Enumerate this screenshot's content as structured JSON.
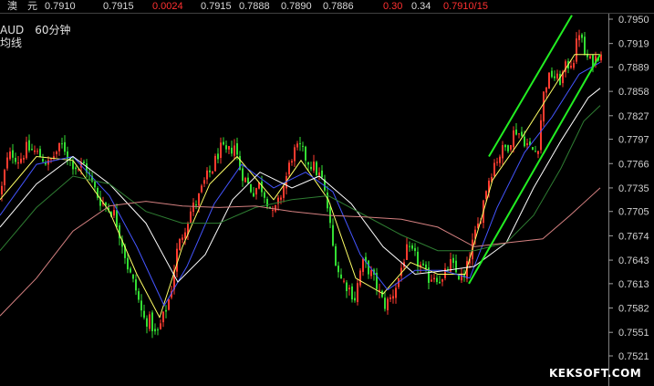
{
  "quote_bar": {
    "name": "澳　元",
    "fields": [
      {
        "value": "0.7910",
        "color": "white"
      },
      {
        "value": "0.7915",
        "color": "white"
      },
      {
        "value": "0.0024",
        "color": "red"
      },
      {
        "value": "0.7915",
        "color": "white"
      },
      {
        "value": "0.7888",
        "color": "white"
      },
      {
        "value": "0.7890",
        "color": "white"
      },
      {
        "value": "0.7886",
        "color": "white"
      },
      {
        "value": "0.30",
        "color": "red"
      },
      {
        "value": "0.34",
        "color": "white"
      },
      {
        "value": "0.7910/15",
        "color": "red"
      }
    ]
  },
  "symbol_label": "AUD　60分钟",
  "indicator_label": "均线",
  "watermark": "KEKSOFT.COM",
  "colors": {
    "background": "#000000",
    "up_candle": "#ff3b2f",
    "down_candle": "#33dd33",
    "ma_short": "#ffff66",
    "ma_mid": "#ffffff",
    "ma_blue": "#4455ff",
    "ma_green": "#2e7d32",
    "ma_long": "#d48080",
    "channel": "#22ee22"
  },
  "chart_data": {
    "type": "candlestick",
    "ylim": [
      0.7515,
      0.796
    ],
    "y_ticks": [
      "0.7950",
      "0.7919",
      "0.7889",
      "0.7858",
      "0.7827",
      "0.7797",
      "0.7766",
      "0.7735",
      "0.7705",
      "0.7674",
      "0.7643",
      "0.7613",
      "0.7582",
      "0.7551",
      "0.7521"
    ],
    "close_path": [
      [
        0,
        0.7728
      ],
      [
        6,
        0.7768
      ],
      [
        12,
        0.778
      ],
      [
        20,
        0.777
      ],
      [
        28,
        0.7785
      ],
      [
        36,
        0.7782
      ],
      [
        44,
        0.7775
      ],
      [
        52,
        0.7765
      ],
      [
        60,
        0.778
      ],
      [
        68,
        0.779
      ],
      [
        76,
        0.777
      ],
      [
        84,
        0.776
      ],
      [
        92,
        0.7765
      ],
      [
        100,
        0.774
      ],
      [
        108,
        0.772
      ],
      [
        116,
        0.7712
      ],
      [
        124,
        0.7702
      ],
      [
        132,
        0.767
      ],
      [
        140,
        0.763
      ],
      [
        148,
        0.7605
      ],
      [
        156,
        0.7568
      ],
      [
        164,
        0.7565
      ],
      [
        170,
        0.7545
      ],
      [
        178,
        0.757
      ],
      [
        186,
        0.76
      ],
      [
        192,
        0.765
      ],
      [
        200,
        0.768
      ],
      [
        208,
        0.7705
      ],
      [
        216,
        0.772
      ],
      [
        224,
        0.7745
      ],
      [
        232,
        0.776
      ],
      [
        240,
        0.7785
      ],
      [
        248,
        0.7778
      ],
      [
        256,
        0.779
      ],
      [
        262,
        0.776
      ],
      [
        268,
        0.7745
      ],
      [
        276,
        0.773
      ],
      [
        284,
        0.774
      ],
      [
        292,
        0.772
      ],
      [
        298,
        0.77
      ],
      [
        304,
        0.7715
      ],
      [
        312,
        0.7745
      ],
      [
        320,
        0.778
      ],
      [
        328,
        0.7785
      ],
      [
        336,
        0.777
      ],
      [
        344,
        0.776
      ],
      [
        352,
        0.7745
      ],
      [
        358,
        0.771
      ],
      [
        364,
        0.766
      ],
      [
        372,
        0.762
      ],
      [
        380,
        0.761
      ],
      [
        388,
        0.7595
      ],
      [
        396,
        0.764
      ],
      [
        404,
        0.763
      ],
      [
        412,
        0.761
      ],
      [
        420,
        0.7585
      ],
      [
        428,
        0.7595
      ],
      [
        436,
        0.762
      ],
      [
        444,
        0.7655
      ],
      [
        452,
        0.765
      ],
      [
        460,
        0.7635
      ],
      [
        468,
        0.762
      ],
      [
        476,
        0.7625
      ],
      [
        484,
        0.7615
      ],
      [
        492,
        0.764
      ],
      [
        500,
        0.7625
      ],
      [
        508,
        0.7618
      ],
      [
        516,
        0.766
      ],
      [
        524,
        0.769
      ],
      [
        532,
        0.7735
      ],
      [
        540,
        0.7765
      ],
      [
        548,
        0.778
      ],
      [
        556,
        0.779
      ],
      [
        564,
        0.781
      ],
      [
        572,
        0.78
      ],
      [
        580,
        0.7785
      ],
      [
        588,
        0.778
      ],
      [
        596,
        0.7865
      ],
      [
        604,
        0.788
      ],
      [
        612,
        0.787
      ],
      [
        620,
        0.789
      ],
      [
        628,
        0.79
      ],
      [
        634,
        0.7935
      ],
      [
        640,
        0.7905
      ],
      [
        646,
        0.7895
      ],
      [
        652,
        0.79
      ],
      [
        658,
        0.7912
      ]
    ],
    "ma_series": [
      {
        "key": "ma_short",
        "points": [
          [
            0,
            0.772
          ],
          [
            40,
            0.7775
          ],
          [
            80,
            0.777
          ],
          [
            120,
            0.7705
          ],
          [
            150,
            0.7625
          ],
          [
            175,
            0.757
          ],
          [
            200,
            0.766
          ],
          [
            230,
            0.774
          ],
          [
            260,
            0.7775
          ],
          [
            300,
            0.772
          ],
          [
            330,
            0.777
          ],
          [
            360,
            0.772
          ],
          [
            390,
            0.762
          ],
          [
            420,
            0.76
          ],
          [
            450,
            0.764
          ],
          [
            480,
            0.7625
          ],
          [
            510,
            0.7625
          ],
          [
            540,
            0.7745
          ],
          [
            570,
            0.7795
          ],
          [
            600,
            0.785
          ],
          [
            630,
            0.7905
          ],
          [
            658,
            0.7905
          ]
        ]
      },
      {
        "key": "ma_blue",
        "points": [
          [
            0,
            0.77
          ],
          [
            40,
            0.7765
          ],
          [
            80,
            0.7775
          ],
          [
            120,
            0.7725
          ],
          [
            150,
            0.766
          ],
          [
            180,
            0.7585
          ],
          [
            205,
            0.7635
          ],
          [
            235,
            0.7715
          ],
          [
            265,
            0.7765
          ],
          [
            300,
            0.7735
          ],
          [
            335,
            0.7755
          ],
          [
            365,
            0.773
          ],
          [
            395,
            0.765
          ],
          [
            425,
            0.7605
          ],
          [
            455,
            0.763
          ],
          [
            485,
            0.763
          ],
          [
            515,
            0.762
          ],
          [
            545,
            0.771
          ],
          [
            575,
            0.778
          ],
          [
            605,
            0.7825
          ],
          [
            635,
            0.788
          ],
          [
            658,
            0.7895
          ]
        ]
      },
      {
        "key": "ma_mid",
        "points": [
          [
            0,
            0.7685
          ],
          [
            40,
            0.774
          ],
          [
            80,
            0.7775
          ],
          [
            120,
            0.774
          ],
          [
            160,
            0.769
          ],
          [
            195,
            0.7615
          ],
          [
            225,
            0.765
          ],
          [
            255,
            0.772
          ],
          [
            285,
            0.7755
          ],
          [
            320,
            0.7735
          ],
          [
            350,
            0.775
          ],
          [
            385,
            0.7715
          ],
          [
            420,
            0.766
          ],
          [
            455,
            0.7625
          ],
          [
            490,
            0.763
          ],
          [
            520,
            0.7635
          ],
          [
            555,
            0.7665
          ],
          [
            585,
            0.7735
          ],
          [
            615,
            0.7795
          ],
          [
            645,
            0.785
          ],
          [
            658,
            0.7862
          ]
        ]
      },
      {
        "key": "ma_green",
        "points": [
          [
            0,
            0.7655
          ],
          [
            40,
            0.771
          ],
          [
            80,
            0.775
          ],
          [
            120,
            0.774
          ],
          [
            160,
            0.7705
          ],
          [
            200,
            0.769
          ],
          [
            240,
            0.769
          ],
          [
            280,
            0.771
          ],
          [
            320,
            0.772
          ],
          [
            360,
            0.7725
          ],
          [
            400,
            0.77
          ],
          [
            440,
            0.7675
          ],
          [
            480,
            0.7655
          ],
          [
            520,
            0.7655
          ],
          [
            555,
            0.7665
          ],
          [
            585,
            0.77
          ],
          [
            615,
            0.776
          ],
          [
            640,
            0.782
          ],
          [
            658,
            0.784
          ]
        ]
      },
      {
        "key": "ma_long",
        "points": [
          [
            0,
            0.7572
          ],
          [
            40,
            0.762
          ],
          [
            80,
            0.768
          ],
          [
            120,
            0.7712
          ],
          [
            160,
            0.7718
          ],
          [
            200,
            0.7712
          ],
          [
            240,
            0.771
          ],
          [
            280,
            0.7712
          ],
          [
            320,
            0.7705
          ],
          [
            360,
            0.77
          ],
          [
            400,
            0.7698
          ],
          [
            440,
            0.7695
          ],
          [
            480,
            0.7685
          ],
          [
            520,
            0.766
          ],
          [
            555,
            0.7665
          ],
          [
            595,
            0.767
          ],
          [
            625,
            0.77
          ],
          [
            658,
            0.7735
          ]
        ]
      }
    ],
    "channel_lines": [
      [
        [
          514,
          0.7613
        ],
        [
          658,
          0.7905
        ]
      ],
      [
        [
          536,
          0.7775
        ],
        [
          627,
          0.7955
        ]
      ]
    ]
  }
}
